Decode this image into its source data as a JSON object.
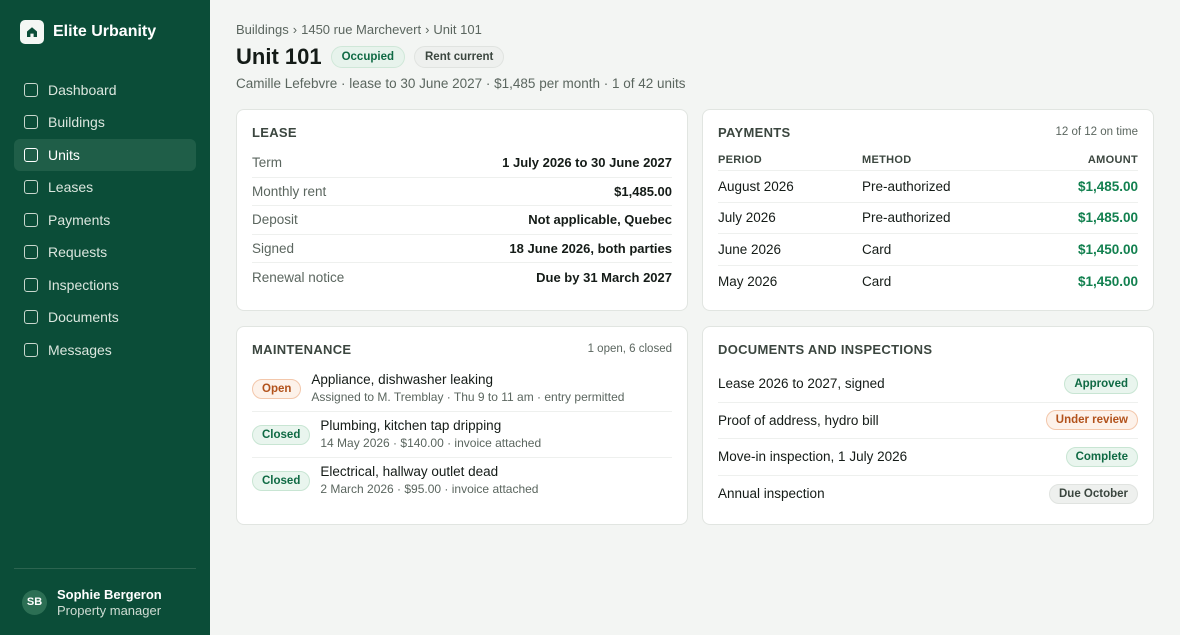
{
  "app": {
    "name": "Elite Urbanity",
    "logo_icon": "home-icon"
  },
  "sidebar": {
    "items": [
      {
        "label": "Dashboard",
        "active": false
      },
      {
        "label": "Buildings",
        "active": false
      },
      {
        "label": "Units",
        "active": true
      },
      {
        "label": "Leases",
        "active": false
      },
      {
        "label": "Payments",
        "active": false
      },
      {
        "label": "Requests",
        "active": false
      },
      {
        "label": "Inspections",
        "active": false
      },
      {
        "label": "Documents",
        "active": false
      },
      {
        "label": "Messages",
        "active": false
      }
    ],
    "user": {
      "initials": "SB",
      "name": "Sophie Bergeron",
      "role": "Property manager"
    }
  },
  "header": {
    "breadcrumb": [
      "Buildings",
      "1450 rue Marchevert",
      "Unit 101"
    ],
    "title": "Unit 101",
    "badges": {
      "occupied": "Occupied",
      "rent": "Rent current"
    },
    "subtitle": "Camille Lefebvre · lease to 30 June 2027 · $1,485 per month · 1 of 42 units"
  },
  "lease": {
    "title": "LEASE",
    "rows": [
      {
        "key": "Term",
        "value": "1 July 2026 to 30 June 2027"
      },
      {
        "key": "Monthly rent",
        "value": "$1,485.00"
      },
      {
        "key": "Deposit",
        "value": "Not applicable, Quebec"
      },
      {
        "key": "Signed",
        "value": "18 June 2026, both parties"
      },
      {
        "key": "Renewal notice",
        "value": "Due by 31 March 2027"
      }
    ]
  },
  "payments": {
    "title": "PAYMENTS",
    "meta": "12 of 12 on time",
    "columns": [
      "PERIOD",
      "METHOD",
      "AMOUNT"
    ],
    "rows": [
      {
        "period": "August 2026",
        "method": "Pre-authorized",
        "amount": "$1,485.00"
      },
      {
        "period": "July 2026",
        "method": "Pre-authorized",
        "amount": "$1,485.00"
      },
      {
        "period": "June 2026",
        "method": "Card",
        "amount": "$1,450.00"
      },
      {
        "period": "May 2026",
        "method": "Card",
        "amount": "$1,450.00"
      }
    ]
  },
  "maintenance": {
    "title": "MAINTENANCE",
    "meta": "1 open, 6 closed",
    "items": [
      {
        "status": "Open",
        "title": "Appliance, dishwasher leaking",
        "detail": "Assigned to M. Tremblay · Thu 9 to 11 am · entry permitted"
      },
      {
        "status": "Closed",
        "title": "Plumbing, kitchen tap dripping",
        "detail": "14 May 2026 · $140.00 · invoice attached"
      },
      {
        "status": "Closed",
        "title": "Electrical, hallway outlet dead",
        "detail": "2 March 2026 · $95.00 · invoice attached"
      }
    ]
  },
  "documents": {
    "title": "DOCUMENTS AND INSPECTIONS",
    "items": [
      {
        "name": "Lease 2026 to 2027, signed",
        "status": "Approved"
      },
      {
        "name": "Proof of address, hydro bill",
        "status": "Under review"
      },
      {
        "name": "Move-in inspection, 1 July 2026",
        "status": "Complete"
      },
      {
        "name": "Annual inspection",
        "status": "Due October"
      }
    ]
  },
  "colors": {
    "sidebar": "#0b4d38",
    "accent_green": "#12804f",
    "warning": "#b2521b"
  }
}
